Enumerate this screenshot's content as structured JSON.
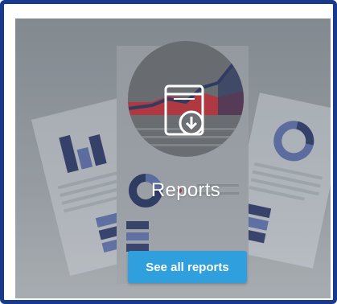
{
  "widget": {
    "title": "Reports",
    "button_label": "See all reports",
    "icon": "report-download-icon"
  },
  "colors": {
    "frame_border": "#173a8c",
    "button_bg": "#2f9fdd",
    "chart_navy": "#2e3b63",
    "chart_red": "#b9373f",
    "chart_blue": "#5d6ea3"
  }
}
